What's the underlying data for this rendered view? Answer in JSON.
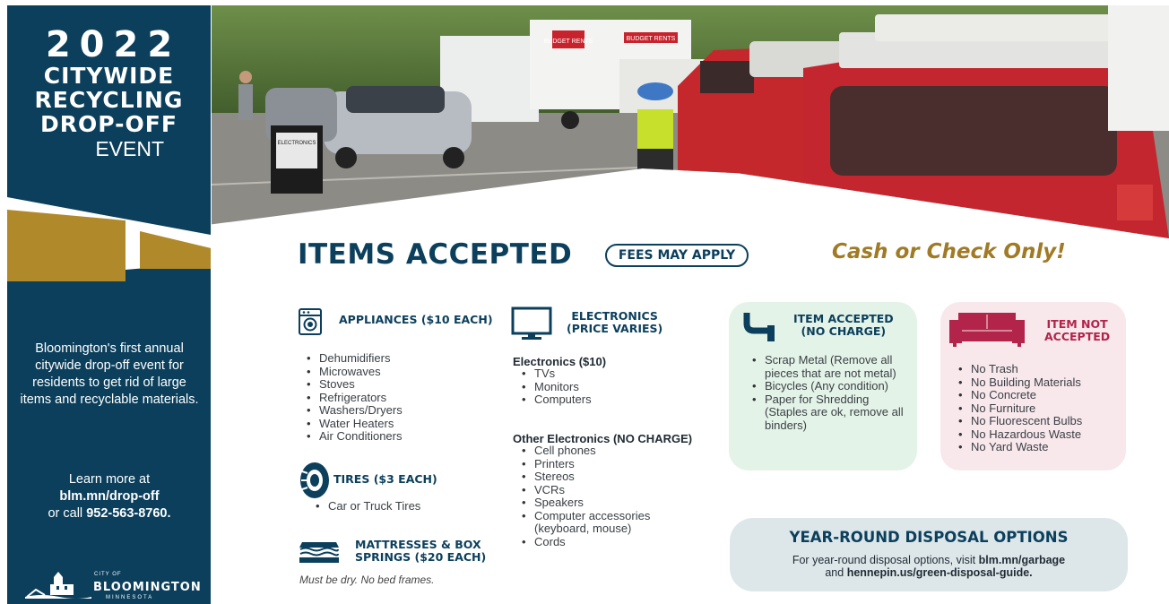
{
  "hero": {
    "year": "2022",
    "line1": "CITYWIDE",
    "line2": "RECYCLING",
    "line3": "DROP-OFF",
    "line4": "EVENT"
  },
  "sidebar": {
    "blurb": "Bloomington's first annual citywide drop-off event for residents to get rid of large items and recyclable materials.",
    "learn_prefix": "Learn more at",
    "learn_link": "blm.mn/drop-off",
    "call_prefix": "or call",
    "phone": "952-563-8760.",
    "logo_city_of": "CITY OF",
    "logo_name": "BLOOMINGTON",
    "logo_state": "MINNESOTA"
  },
  "photo": {
    "truck_brand_1": "BUDGET RENTS",
    "truck_brand_2": "BUDGET RENTS",
    "sign_text": "ELECTRONICS"
  },
  "headline": {
    "title": "ITEMS ACCEPTED",
    "fees": "FEES MAY APPLY",
    "payment": "Cash or Check Only!"
  },
  "appliances": {
    "heading": "APPLIANCES ($10 EACH)",
    "items": [
      "Dehumidifiers",
      "Microwaves",
      "Stoves",
      "Refrigerators",
      "Washers/Dryers",
      "Water Heaters",
      "Air Conditioners"
    ]
  },
  "tires": {
    "heading": "TIRES ($3 EACH)",
    "items": [
      "Car or Truck Tires"
    ]
  },
  "mattresses": {
    "heading_1": "MATTRESSES & BOX",
    "heading_2": "SPRINGS ($20 EACH)",
    "note": "Must be dry.  No bed frames."
  },
  "electronics": {
    "heading_1": "ELECTRONICS",
    "heading_2": "(PRICE VARIES)",
    "paid_heading": "Electronics ($10)",
    "paid_items": [
      "TVs",
      "Monitors",
      "Computers"
    ],
    "free_heading": "Other Electronics (NO CHARGE)",
    "free_items": [
      "Cell phones",
      "Printers",
      "Stereos",
      "VCRs",
      "Speakers",
      "Computer accessories (keyboard, mouse)",
      "Cords"
    ]
  },
  "no_charge": {
    "heading_1": "ITEM ACCEPTED",
    "heading_2": "(NO CHARGE)",
    "items": [
      "Scrap Metal (Remove all pieces that are not metal)",
      "Bicycles (Any condition)",
      "Paper for Shredding (Staples are ok, remove all binders)"
    ]
  },
  "not_accepted": {
    "heading_1": "ITEM NOT",
    "heading_2": "ACCEPTED",
    "items": [
      "No Trash",
      "No Building Materials",
      "No Concrete",
      "No Furniture",
      "No Fluorescent Bulbs",
      "No Hazardous Waste",
      "No Yard Waste"
    ]
  },
  "year_round": {
    "heading": "YEAR-ROUND DISPOSAL OPTIONS",
    "text_prefix": "For year-round disposal options, visit",
    "link_1": "blm.mn/garbage",
    "and": "and",
    "link_2": "hennepin.us/green-disposal-guide."
  },
  "colors": {
    "navy": "#0b3f5c",
    "gold": "#b0892a",
    "green_card": "#e4f3e8",
    "pink_card": "#f8e8ec",
    "not_accepted_red": "#b2244a",
    "blue_card": "#dde7ea"
  }
}
